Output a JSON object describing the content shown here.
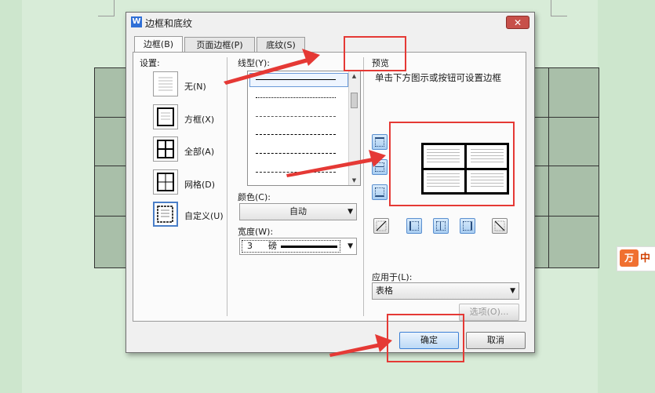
{
  "dialog": {
    "title": "边框和底纹",
    "logo": "W",
    "close_glyph": "✕",
    "tabs": [
      {
        "label": "边框(B)",
        "active": true
      },
      {
        "label": "页面边框(P)",
        "active": false
      },
      {
        "label": "底纹(S)",
        "active": false
      }
    ],
    "settings": {
      "heading": "设置:",
      "items": [
        {
          "label": "无(N)",
          "icon": "none-border-icon"
        },
        {
          "label": "方框(X)",
          "icon": "box-border-icon"
        },
        {
          "label": "全部(A)",
          "icon": "all-border-icon"
        },
        {
          "label": "网格(D)",
          "icon": "grid-border-icon"
        },
        {
          "label": "自定义(U)",
          "icon": "custom-border-icon",
          "selected": true
        }
      ]
    },
    "line_style": {
      "heading": "线型(Y):",
      "styles": [
        "solid",
        "dotted",
        "dashed-small",
        "dashed",
        "dash-dot",
        "dash-dot-dot"
      ]
    },
    "color": {
      "heading": "颜色(C):",
      "value": "自动"
    },
    "width": {
      "heading": "宽度(W):",
      "value_num": "3",
      "value_unit": "磅"
    },
    "preview": {
      "heading": "预览",
      "hint": "单击下方图示或按钮可设置边框"
    },
    "apply_to": {
      "heading": "应用于(L):",
      "value": "表格"
    },
    "buttons": {
      "options": "选项(O)...",
      "ok": "确定",
      "cancel": "取消"
    }
  },
  "side_widget": {
    "logo": "万",
    "text": "中"
  },
  "colors": {
    "background": "#cde6cd",
    "annotation_red": "#e53935",
    "selection_blue": "#4a7fc8"
  }
}
